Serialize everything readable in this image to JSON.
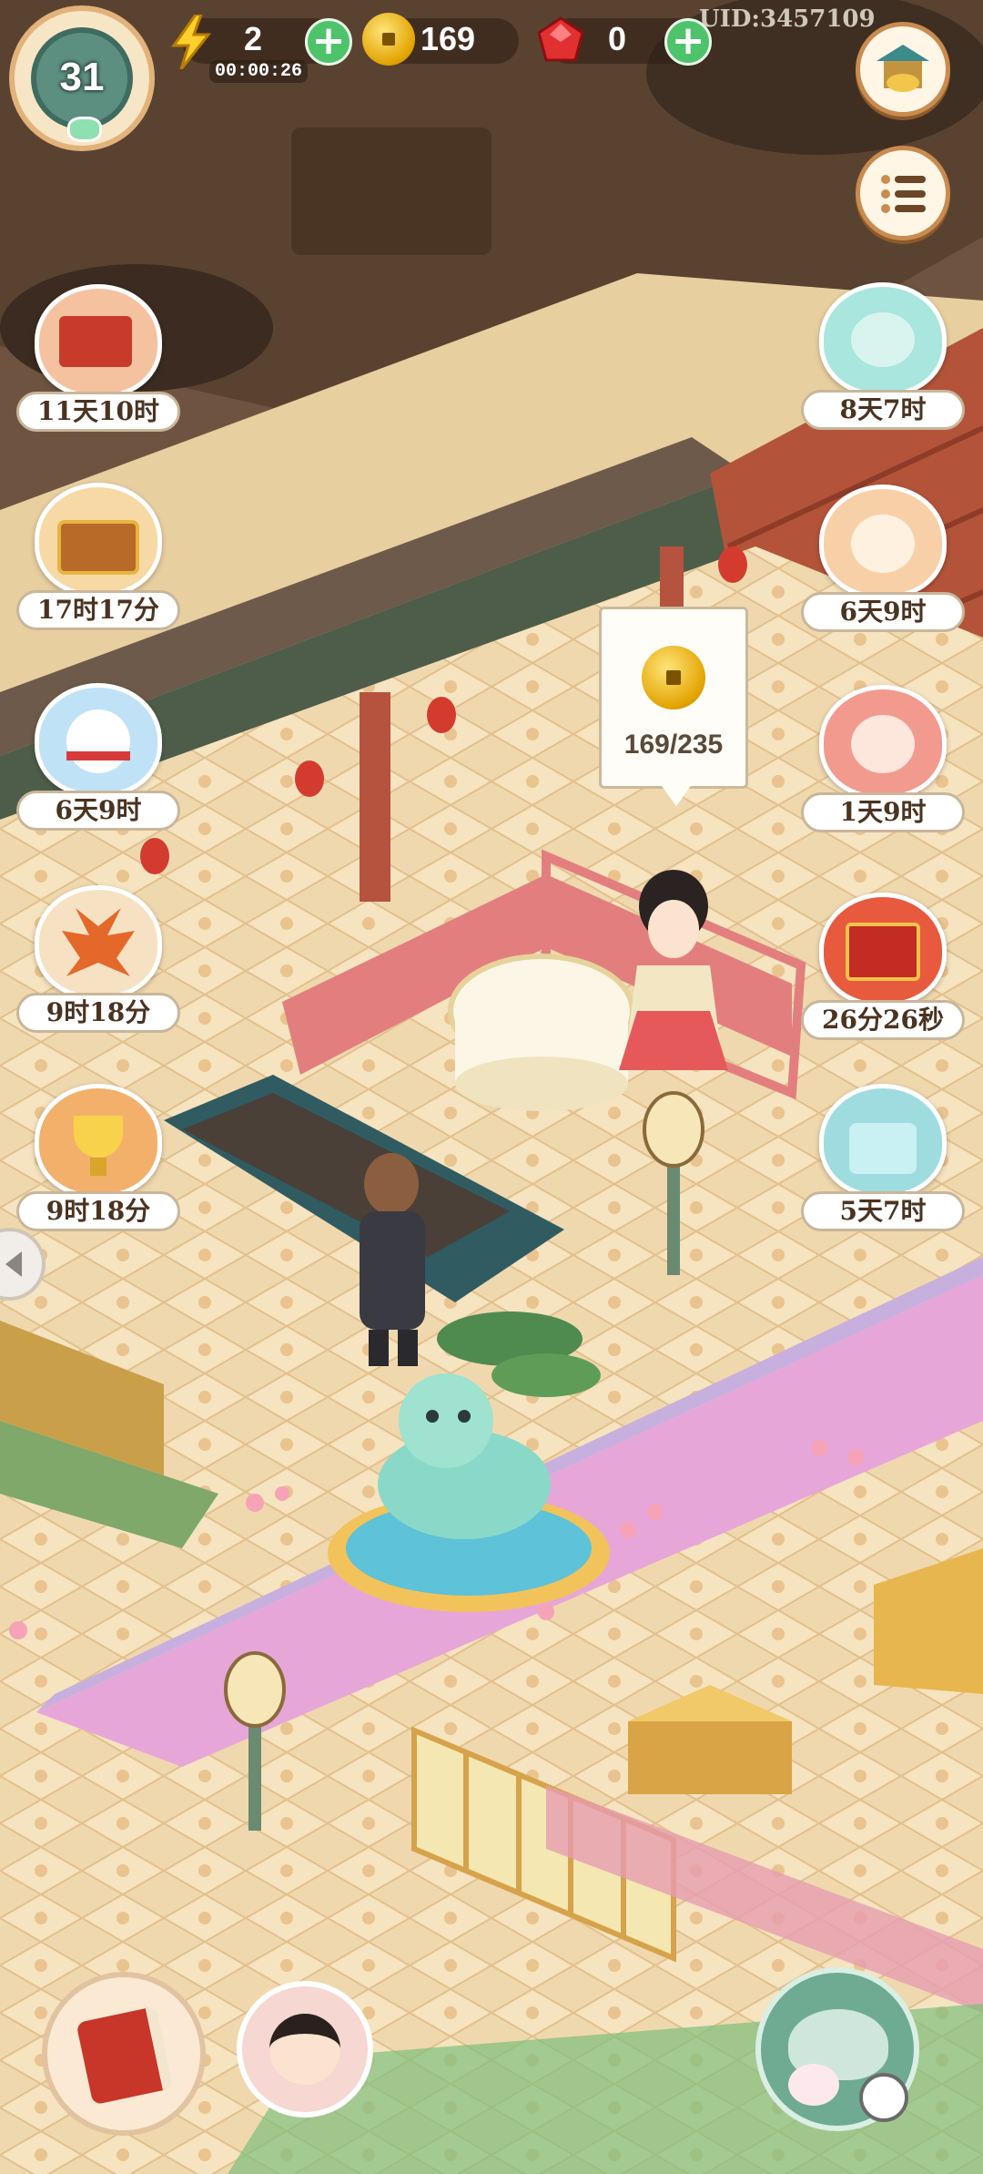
{
  "hud": {
    "level": "31",
    "energy": "2",
    "energy_timer": "00:00:26",
    "coins": "169",
    "gems": "0",
    "uid": "UID:3457109"
  },
  "left_events": [
    {
      "name": "autumn-scroll-event",
      "timer": "11天10时",
      "color": "#d9482f"
    },
    {
      "name": "treasure-chest-event",
      "timer": "17时17分",
      "color": "#e8a03a"
    },
    {
      "name": "snow-cat-event",
      "timer": "6天9时",
      "color": "#9ed2f0"
    },
    {
      "name": "maple-leaf-event",
      "timer": "9时18分",
      "color": "#e8743a"
    },
    {
      "name": "golden-cup-event",
      "timer": "9时18分",
      "color": "#e0892e"
    }
  ],
  "right_events": [
    {
      "name": "jade-cat-event",
      "timer": "8天7时",
      "color": "#7fd0c8"
    },
    {
      "name": "fan-cat-event",
      "timer": "6天9时",
      "color": "#f0a36a"
    },
    {
      "name": "opera-cat-event",
      "timer": "1天9时",
      "color": "#e85a4a"
    },
    {
      "name": "red-box-event",
      "timer": "26分26秒",
      "color": "#d63a2a"
    },
    {
      "name": "gift-cat-event",
      "timer": "5天7时",
      "color": "#8fd5d8"
    }
  ],
  "coin_bubble": {
    "value": "169/235"
  },
  "colors": {
    "floor": "#efd6ab",
    "carpet": "#e7a6d8",
    "railing": "#e0787a",
    "wall": "#6b4a33"
  }
}
